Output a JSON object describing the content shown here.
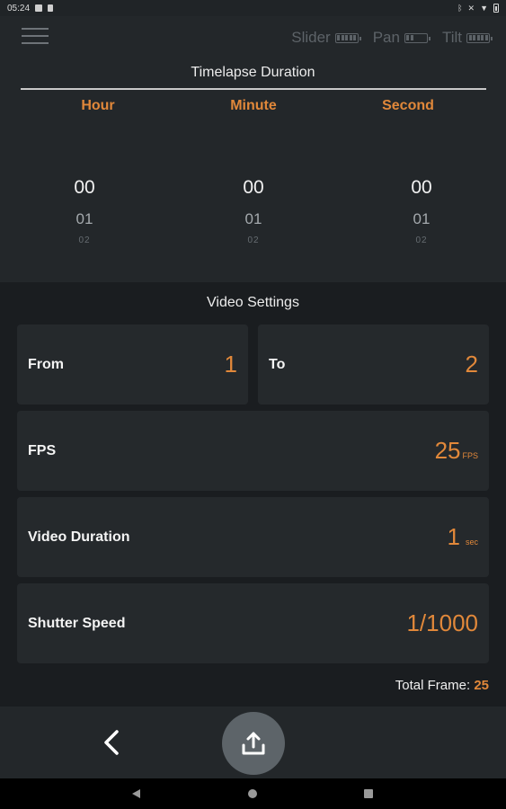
{
  "status_bar": {
    "time": "05:24"
  },
  "devices": [
    {
      "name": "Slider",
      "battery": "full"
    },
    {
      "name": "Pan",
      "battery": "half"
    },
    {
      "name": "Tilt",
      "battery": "full"
    }
  ],
  "timelapse": {
    "title": "Timelapse Duration",
    "columns": [
      {
        "label": "Hour",
        "selected": "00",
        "next": "01",
        "after": "02"
      },
      {
        "label": "Minute",
        "selected": "00",
        "next": "01",
        "after": "02"
      },
      {
        "label": "Second",
        "selected": "00",
        "next": "01",
        "after": "02"
      }
    ]
  },
  "video_settings": {
    "title": "Video Settings",
    "from": {
      "label": "From",
      "value": "1"
    },
    "to": {
      "label": "To",
      "value": "2"
    },
    "fps": {
      "label": "FPS",
      "value": "25",
      "unit": "FPS"
    },
    "video_duration": {
      "label": "Video Duration",
      "value": "1",
      "unit": "sec"
    },
    "shutter_speed": {
      "label": "Shutter Speed",
      "value": "1/1000"
    }
  },
  "total_frame": {
    "label": "Total Frame:",
    "value": "25"
  },
  "colors": {
    "accent": "#e1883a",
    "panel": "#23272a",
    "card": "#25292c",
    "background": "#1a1d20"
  },
  "icons": {
    "menu": "hamburger-menu-icon",
    "back": "chevron-left-icon",
    "share": "upload-icon",
    "nav_back": "triangle-back-icon",
    "nav_home": "circle-home-icon",
    "nav_recents": "square-recents-icon"
  }
}
